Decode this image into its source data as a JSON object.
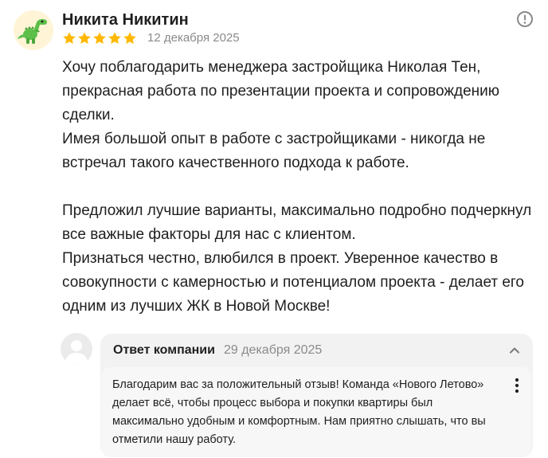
{
  "review": {
    "author": "Никита Никитин",
    "rating": 5,
    "rating_max": 5,
    "date": "12 декабря 2025",
    "avatar_icon": "dinosaur-icon",
    "star_color": "#ffb800",
    "report_icon": "exclamation-circle-icon",
    "paragraphs": [
      "Хочу поблагодарить менеджера застройщика Николая Тен, прекрасная работа по презентации проекта и сопровождению сделки.",
      "Имея большой опыт в работе с застройщиками - никогда не встречал такого качественного подхода к работе.",
      "Предложил лучшие варианты, максимально подробно подчеркнул все важные факторы для нас с клиентом.",
      "Признаться честно, влюбился в проект. Уверенное качество в совокупности с камерностью и потенциалом проекта - делает его одним из лучших ЖК в Новой Москве!"
    ]
  },
  "company_reply": {
    "title": "Ответ компании",
    "date": "29 декабря 2025",
    "text": "Благодарим вас за положительный отзыв! Команда «Нового Летово» делает всё, чтобы процесс выбора и покупки квартиры был максимально удобным и комфортным. Нам приятно слышать, что вы отметили нашу работу.",
    "avatar_icon": "user-placeholder-icon",
    "collapse_icon": "chevron-up-icon",
    "menu_icon": "more-vertical-icon"
  }
}
